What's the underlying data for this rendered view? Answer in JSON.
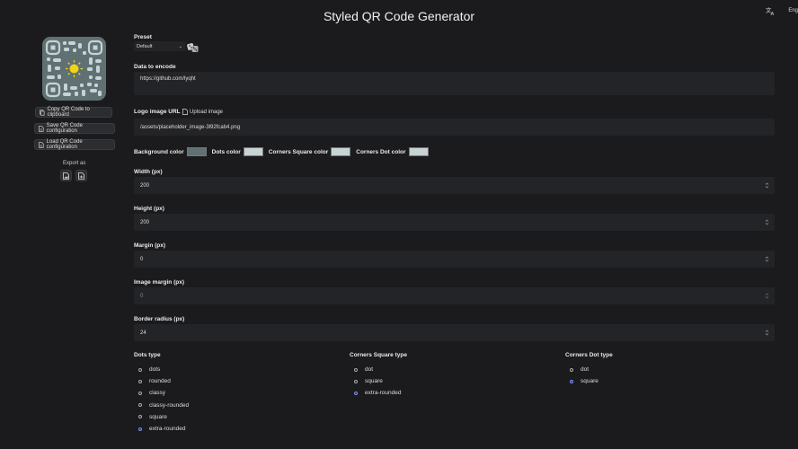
{
  "header": {
    "title": "Styled QR Code Generator",
    "language": "Eng"
  },
  "sidebar": {
    "copy_label": "Copy QR Code to clipboard",
    "save_label": "Save QR Code configuration",
    "load_label": "Load QR Code configuration",
    "export_label": "Export as"
  },
  "form": {
    "preset_label": "Preset",
    "preset_value": "Default",
    "data_label": "Data to encode",
    "data_value": "https://github.com/lyqht",
    "logo_label": "Logo image URL",
    "upload_label": "Upload image",
    "logo_value": "/assets/placeholder_image-3l92fcab4.png",
    "bg_color_label": "Background color",
    "dots_color_label": "Dots color",
    "corners_square_color_label": "Corners Square color",
    "corners_dot_color_label": "Corners Dot color",
    "width_label": "Width (px)",
    "width_value": "200",
    "height_label": "Height (px)",
    "height_value": "200",
    "margin_label": "Margin (px)",
    "margin_value": "0",
    "image_margin_label": "Image margin (px)",
    "image_margin_value": "0",
    "border_radius_label": "Border radius (px)",
    "border_radius_value": "24"
  },
  "colors": {
    "background": "#5f7173",
    "dots": "#c7d3d4",
    "corners_square": "#c7d3d4",
    "corners_dot": "#c7d3d4",
    "accent": "#7d8dfa"
  },
  "dots_type": {
    "title": "Dots type",
    "options": [
      "dots",
      "rounded",
      "classy",
      "classy-rounded",
      "square",
      "extra-rounded"
    ],
    "selected": "extra-rounded"
  },
  "corners_square_type": {
    "title": "Corners Square type",
    "options": [
      "dot",
      "square",
      "extra-rounded"
    ],
    "selected": "extra-rounded"
  },
  "corners_dot_type": {
    "title": "Corners Dot type",
    "options": [
      "dot",
      "square"
    ],
    "selected": "square"
  },
  "icons": {
    "translate": "translate-icon",
    "dice": "dice-icon",
    "copy": "copy-icon",
    "file": "file-icon",
    "export_png": "image-file-icon",
    "export_svg": "svg-file-icon",
    "spin": "spinner-arrows-icon"
  }
}
